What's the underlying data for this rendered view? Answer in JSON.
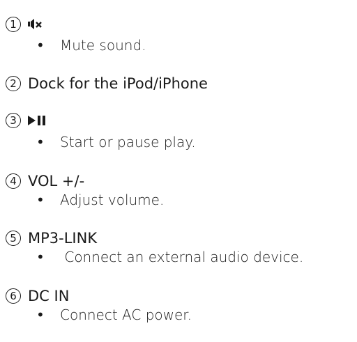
{
  "items": [
    {
      "number": "1",
      "heading": "",
      "icon": "mute-speaker-icon",
      "bullet": "•",
      "description": "Mute sound."
    },
    {
      "number": "2",
      "heading": "Dock for the iPod/iPhone",
      "bullet": "",
      "description": ""
    },
    {
      "number": "3",
      "heading": "",
      "icon": "play-pause-icon",
      "bullet": "•",
      "description": "Start or pause play."
    },
    {
      "number": "4",
      "heading": "VOL +/-",
      "bullet": "•",
      "description": "Adjust volume."
    },
    {
      "number": "5",
      "heading": "MP3-LINK",
      "bullet": "•",
      "description": " Connect an external audio device."
    },
    {
      "number": "6",
      "heading": "DC IN",
      "bullet": "•",
      "description": "Connect AC power."
    }
  ]
}
